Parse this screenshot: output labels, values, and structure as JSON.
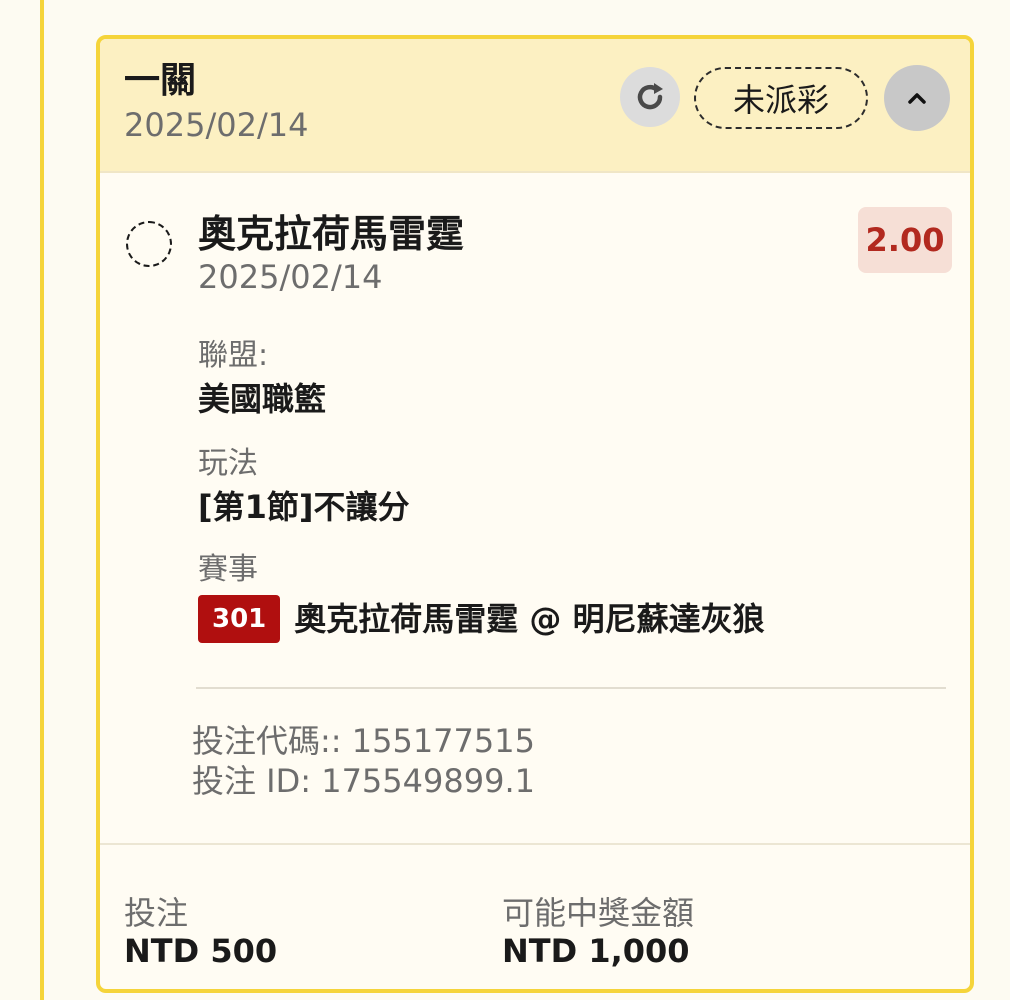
{
  "header": {
    "bet_type": "一關",
    "date": "2025/02/14",
    "status": "未派彩"
  },
  "selection": {
    "team": "奧克拉荷馬雷霆",
    "date": "2025/02/14",
    "odds": "2.00"
  },
  "details": {
    "league_label": "聯盟:",
    "league_value": "美國職籃",
    "market_label": "玩法",
    "market_value": "[第1節]不讓分",
    "event_label": "賽事",
    "event_id": "301",
    "event_name": "奧克拉荷馬雷霆 @ 明尼蘇達灰狼"
  },
  "meta": {
    "bet_code": "投注代碼:: 155177515",
    "bet_id": "投注 ID: 175549899.1"
  },
  "footer": {
    "stake_label": "投注",
    "stake_value": "NTD 500",
    "payout_label": "可能中獎金額",
    "payout_value": "NTD 1,000"
  },
  "icons": {
    "refresh": "refresh-icon",
    "collapse": "chevron-up-icon"
  },
  "colors": {
    "accent_border": "#f5d43a",
    "header_bg": "#fcf0c2",
    "odds_text": "#b2291f",
    "odds_bg": "#f6dfd6",
    "event_id_bg": "#b00f0f"
  }
}
